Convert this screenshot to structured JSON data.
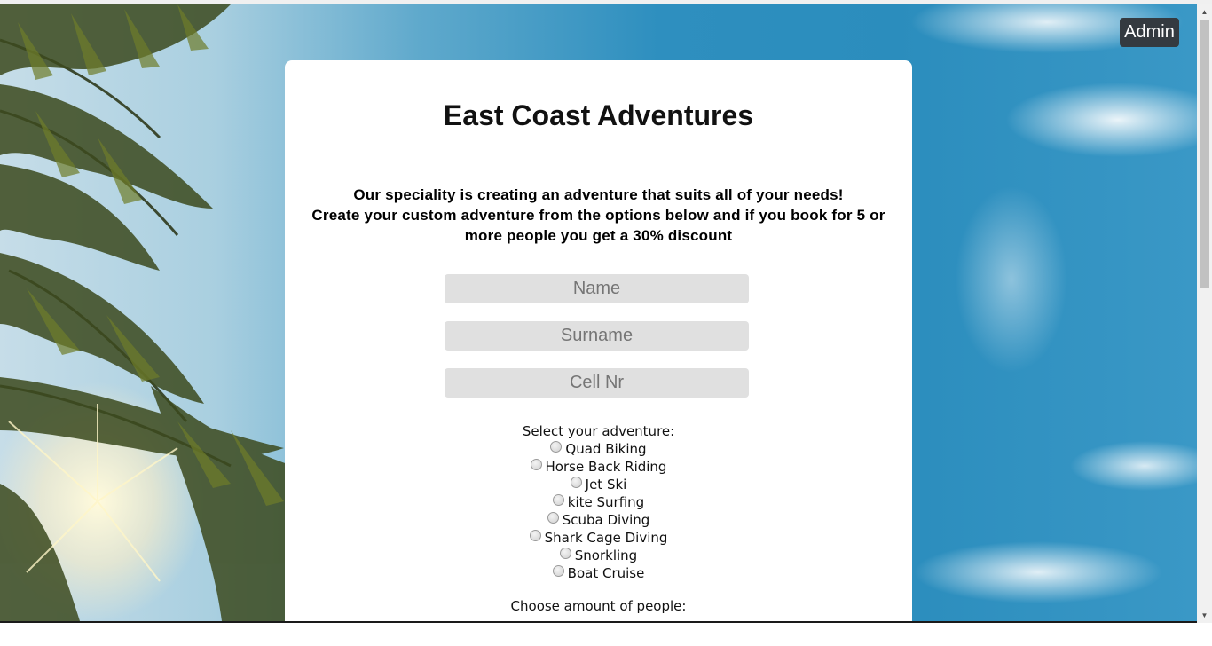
{
  "header": {
    "admin_label": "Admin"
  },
  "main": {
    "title": "East Coast Adventures",
    "intro_line1": "Our speciality is creating an adventure that suits all of your needs!",
    "intro_line2": "Create your custom adventure from the options below and if you book for 5 or more people you get a 30% discount"
  },
  "form": {
    "name_placeholder": "Name",
    "surname_placeholder": "Surname",
    "cell_placeholder": "Cell Nr",
    "adventure_label": "Select your adventure:",
    "adventures": [
      "Quad Biking",
      "Horse Back Riding",
      "Jet Ski",
      "kite Surfing",
      "Scuba Diving",
      "Shark Cage Diving",
      "Snorkling",
      "Boat Cruise"
    ],
    "people_label": "Choose amount of people:"
  },
  "colors": {
    "admin_bg": "#343a40",
    "field_bg": "#e0e0e0",
    "card_bg": "#ffffff"
  }
}
